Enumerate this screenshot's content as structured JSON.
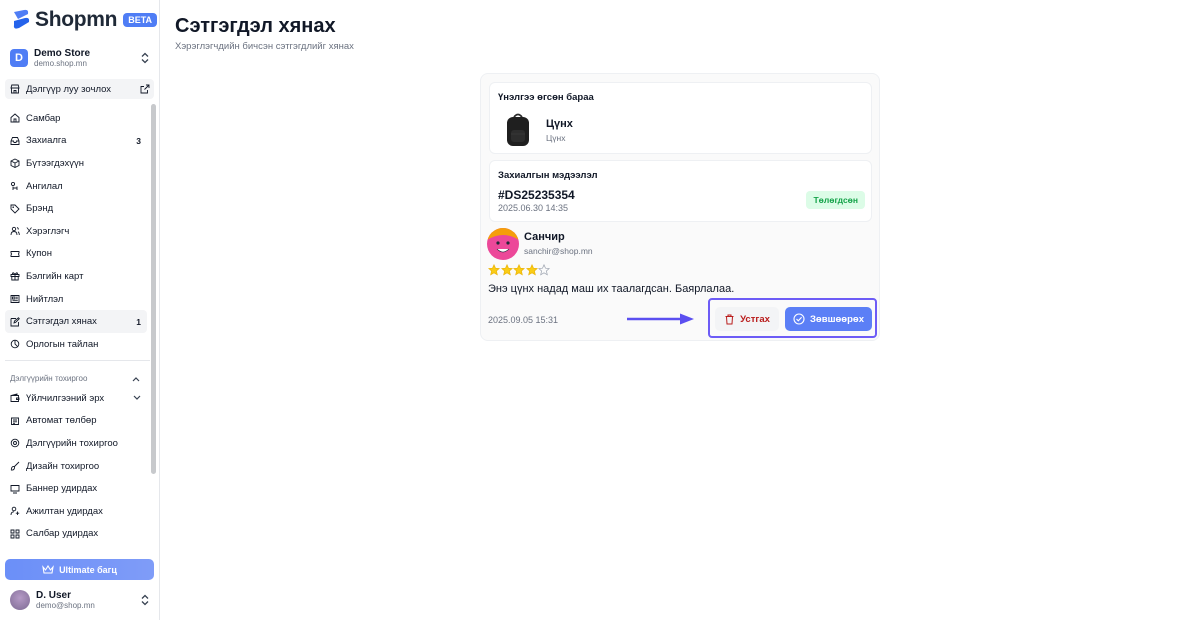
{
  "brand": {
    "name": "Shopmn",
    "badge": "BETA",
    "accent": "#4f7df5"
  },
  "store": {
    "initial": "D",
    "name": "Demo Store",
    "domain": "demo.shop.mn"
  },
  "visit_store": {
    "label": "Дэлгүүр луу зочлох",
    "icon": "external-link-icon"
  },
  "nav": [
    {
      "label": "Самбар",
      "icon": "home-icon",
      "count": ""
    },
    {
      "label": "Захиалга",
      "icon": "inbox-icon",
      "count": "3"
    },
    {
      "label": "Бүтээгдэхүүн",
      "icon": "box-icon",
      "count": ""
    },
    {
      "label": "Ангилал",
      "icon": "shapes-icon",
      "count": ""
    },
    {
      "label": "Брэнд",
      "icon": "tag-icon",
      "count": ""
    },
    {
      "label": "Хэрэглэгч",
      "icon": "users-icon",
      "count": ""
    },
    {
      "label": "Купон",
      "icon": "coupon-icon",
      "count": ""
    },
    {
      "label": "Бэлгийн карт",
      "icon": "gift-icon",
      "count": ""
    },
    {
      "label": "Нийтлэл",
      "icon": "newspaper-icon",
      "count": ""
    },
    {
      "label": "Сэтгэгдэл хянах",
      "icon": "review-icon",
      "count": "1"
    },
    {
      "label": "Орлогын тайлан",
      "icon": "report-icon",
      "count": ""
    }
  ],
  "settings_section": {
    "title": "Дэлгүүрийн тохиргоо"
  },
  "settings_nav": [
    {
      "label": "Үйлчилгээний эрх",
      "icon": "wallet-icon"
    },
    {
      "label": "Автомат төлбөр",
      "icon": "card-icon"
    },
    {
      "label": "Дэлгүүрийн тохиргоо",
      "icon": "settings-icon"
    },
    {
      "label": "Дизайн тохиргоо",
      "icon": "brush-icon"
    },
    {
      "label": "Баннер удирдах",
      "icon": "banner-icon"
    },
    {
      "label": "Ажилтан удирдах",
      "icon": "user-cog-icon"
    },
    {
      "label": "Салбар удирдах",
      "icon": "branch-icon"
    }
  ],
  "upgrade": {
    "label": "Ultimate багц"
  },
  "user": {
    "name": "D. User",
    "email": "demo@shop.mn"
  },
  "page": {
    "title": "Сэтгэгдэл хянах",
    "subtitle": "Хэрэглэгчдийн бичсэн сэтгэгдлийг хянах"
  },
  "review": {
    "product_section_title": "Үнэлгээ өгсөн бараа",
    "product_name": "Цүнх",
    "product_category": "Цүнх",
    "order_section_title": "Захиалгын мэдээлэл",
    "order_id": "#DS25235354",
    "order_date": "2025.06.30 14:35",
    "order_status": "Төлөгдсөн",
    "reviewer_name": "Санчир",
    "reviewer_email": "sanchir@shop.mn",
    "rating": 4,
    "rating_max": 5,
    "text": "Энэ цүнх надад маш их таалагдсан. Баярлалаа.",
    "date": "2025.09.05 15:31",
    "delete_label": "Устгах",
    "approve_label": "Зөвшөөрөх"
  }
}
